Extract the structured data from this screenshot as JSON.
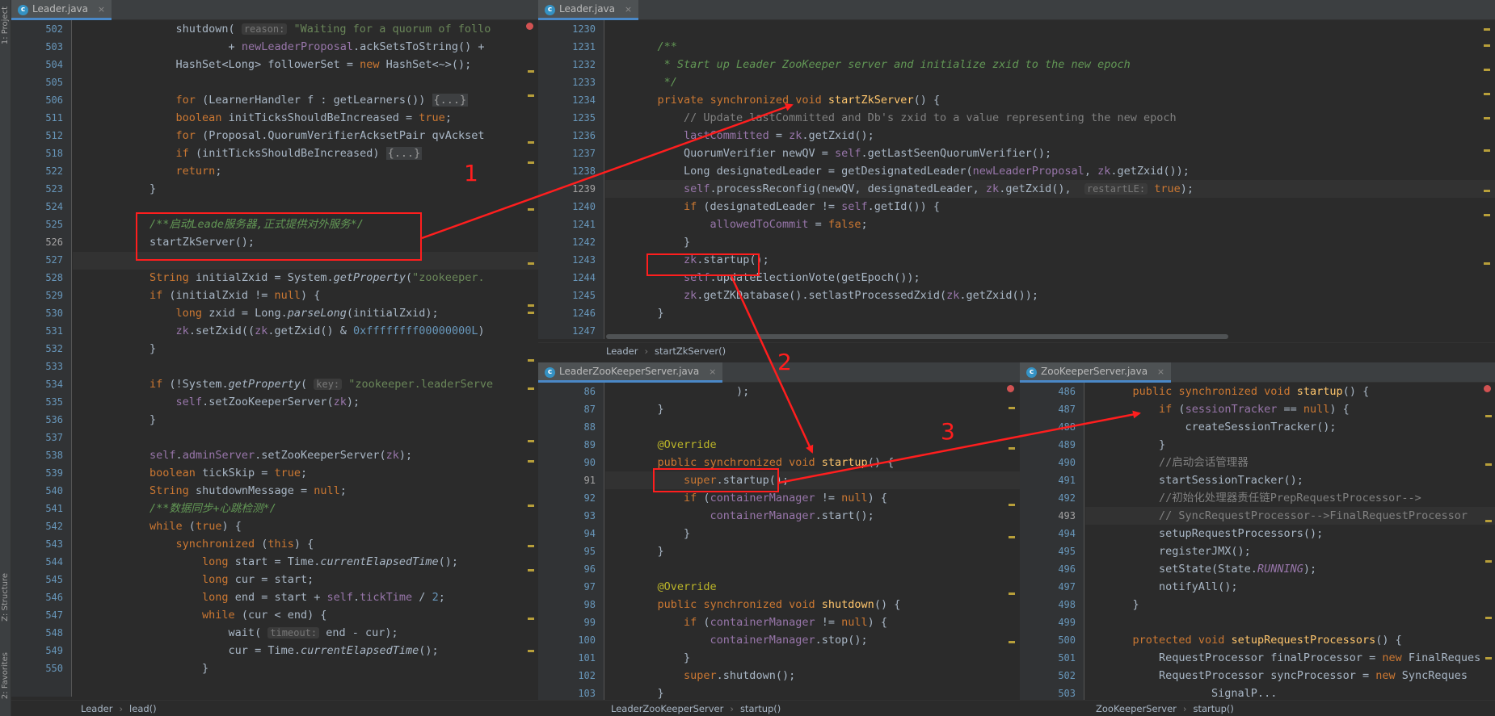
{
  "sidebar": {
    "project_label": "1: Project",
    "structure_label": "Z: Structure",
    "favorites_label": "2: Favorites"
  },
  "tabs": {
    "leader": "Leader.java",
    "leader_zk": "LeaderZooKeeperServer.java",
    "zk_server": "ZooKeeperServer.java",
    "close_glyph": "×",
    "class_glyph": "c"
  },
  "breadcrumbs": {
    "left": [
      "Leader",
      "lead()"
    ],
    "top_right": [
      "Leader",
      "startZkServer()"
    ],
    "middle": [
      "LeaderZooKeeperServer",
      "startup()"
    ],
    "right": [
      "ZooKeeperServer",
      "startup()"
    ],
    "separator": "›"
  },
  "annotations": {
    "label_1": "1",
    "label_2": "2",
    "label_3": "3"
  },
  "editor_left": {
    "lines": [
      {
        "n": "502",
        "t": "            shutdown( reason: \"Waiting for a quorum of follo"
      },
      {
        "n": "503",
        "t": "                    + newLeaderProposal.ackSetsToString() +"
      },
      {
        "n": "504",
        "t": "            HashSet<Long> followerSet = new HashSet<~>();"
      },
      {
        "n": "505",
        "t": ""
      },
      {
        "n": "506",
        "t": "            for (LearnerHandler f : getLearners()) {...}"
      },
      {
        "n": "511",
        "t": "            boolean initTicksShouldBeIncreased = true;"
      },
      {
        "n": "512",
        "t": "            for (Proposal.QuorumVerifierAcksetPair qvAckset"
      },
      {
        "n": "518",
        "t": "            if (initTicksShouldBeIncreased) {...}"
      },
      {
        "n": "522",
        "t": "            return;"
      },
      {
        "n": "523",
        "t": "        }"
      },
      {
        "n": "524",
        "t": ""
      },
      {
        "n": "525",
        "t": "        /**启动Leade服务器,正式提供对外服务*/"
      },
      {
        "n": "526",
        "t": "        startZkServer();"
      },
      {
        "n": "527",
        "t": ""
      },
      {
        "n": "528",
        "t": "        String initialZxid = System.getProperty(\"zookeeper."
      },
      {
        "n": "529",
        "t": "        if (initialZxid != null) {"
      },
      {
        "n": "530",
        "t": "            long zxid = Long.parseLong(initialZxid);"
      },
      {
        "n": "531",
        "t": "            zk.setZxid((zk.getZxid() & 0xffffffff00000000L)"
      },
      {
        "n": "532",
        "t": "        }"
      },
      {
        "n": "533",
        "t": ""
      },
      {
        "n": "534",
        "t": "        if (!System.getProperty( key: \"zookeeper.leaderServe"
      },
      {
        "n": "535",
        "t": "            self.setZooKeeperServer(zk);"
      },
      {
        "n": "536",
        "t": "        }"
      },
      {
        "n": "537",
        "t": ""
      },
      {
        "n": "538",
        "t": "        self.adminServer.setZooKeeperServer(zk);"
      },
      {
        "n": "539",
        "t": "        boolean tickSkip = true;"
      },
      {
        "n": "540",
        "t": "        String shutdownMessage = null;"
      },
      {
        "n": "541",
        "t": "        /**数据同步+心跳检测*/"
      },
      {
        "n": "542",
        "t": "        while (true) {"
      },
      {
        "n": "543",
        "t": "            synchronized (this) {"
      },
      {
        "n": "544",
        "t": "                long start = Time.currentElapsedTime();"
      },
      {
        "n": "545",
        "t": "                long cur = start;"
      },
      {
        "n": "546",
        "t": "                long end = start + self.tickTime / 2;"
      },
      {
        "n": "547",
        "t": "                while (cur < end) {"
      },
      {
        "n": "548",
        "t": "                    wait( timeout: end - cur);"
      },
      {
        "n": "549",
        "t": "                    cur = Time.currentElapsedTime();"
      },
      {
        "n": "550",
        "t": "                }"
      }
    ]
  },
  "editor_top_right": {
    "lines": [
      {
        "n": "1230",
        "t": ""
      },
      {
        "n": "1231",
        "t": "    /**"
      },
      {
        "n": "1232",
        "t": "     * Start up Leader ZooKeeper server and initialize zxid to the new epoch"
      },
      {
        "n": "1233",
        "t": "     */"
      },
      {
        "n": "1234",
        "t": "    private synchronized void startZkServer() {"
      },
      {
        "n": "1235",
        "t": "        // Update lastCommitted and Db's zxid to a value representing the new epoch"
      },
      {
        "n": "1236",
        "t": "        lastCommitted = zk.getZxid();"
      },
      {
        "n": "1237",
        "t": "        QuorumVerifier newQV = self.getLastSeenQuorumVerifier();"
      },
      {
        "n": "1238",
        "t": "        Long designatedLeader = getDesignatedLeader(newLeaderProposal, zk.getZxid());"
      },
      {
        "n": "1239",
        "t": "        self.processReconfig(newQV, designatedLeader, zk.getZxid(),  restartLE: true);"
      },
      {
        "n": "1240",
        "t": "        if (designatedLeader != self.getId()) {"
      },
      {
        "n": "1241",
        "t": "            allowedToCommit = false;"
      },
      {
        "n": "1242",
        "t": "        }"
      },
      {
        "n": "1243",
        "t": "        zk.startup();"
      },
      {
        "n": "1244",
        "t": "        self.updateElectionVote(getEpoch());"
      },
      {
        "n": "1245",
        "t": "        zk.getZKDatabase().setlastProcessedZxid(zk.getZxid());"
      },
      {
        "n": "1246",
        "t": "    }"
      },
      {
        "n": "1247",
        "t": ""
      }
    ]
  },
  "editor_middle": {
    "lines": [
      {
        "n": "86",
        "t": "                );"
      },
      {
        "n": "87",
        "t": "    }"
      },
      {
        "n": "88",
        "t": ""
      },
      {
        "n": "89",
        "t": "    @Override"
      },
      {
        "n": "90",
        "t": "    public synchronized void startup() {"
      },
      {
        "n": "91",
        "t": "        super.startup();"
      },
      {
        "n": "92",
        "t": "        if (containerManager != null) {"
      },
      {
        "n": "93",
        "t": "            containerManager.start();"
      },
      {
        "n": "94",
        "t": "        }"
      },
      {
        "n": "95",
        "t": "    }"
      },
      {
        "n": "96",
        "t": ""
      },
      {
        "n": "97",
        "t": "    @Override"
      },
      {
        "n": "98",
        "t": "    public synchronized void shutdown() {"
      },
      {
        "n": "99",
        "t": "        if (containerManager != null) {"
      },
      {
        "n": "100",
        "t": "            containerManager.stop();"
      },
      {
        "n": "101",
        "t": "        }"
      },
      {
        "n": "102",
        "t": "        super.shutdown();"
      },
      {
        "n": "103",
        "t": "    }"
      }
    ]
  },
  "editor_right": {
    "lines": [
      {
        "n": "486",
        "t": "    public synchronized void startup() {"
      },
      {
        "n": "487",
        "t": "        if (sessionTracker == null) {"
      },
      {
        "n": "488",
        "t": "            createSessionTracker();"
      },
      {
        "n": "489",
        "t": "        }"
      },
      {
        "n": "490",
        "t": "        //启动会话管理器"
      },
      {
        "n": "491",
        "t": "        startSessionTracker();"
      },
      {
        "n": "492",
        "t": "        //初始化处理器责任链PrepRequestProcessor-->"
      },
      {
        "n": "493",
        "t": "        // SyncRequestProcessor-->FinalRequestProcessor"
      },
      {
        "n": "494",
        "t": "        setupRequestProcessors();"
      },
      {
        "n": "495",
        "t": "        registerJMX();"
      },
      {
        "n": "496",
        "t": "        setState(State.RUNNING);"
      },
      {
        "n": "497",
        "t": "        notifyAll();"
      },
      {
        "n": "498",
        "t": "    }"
      },
      {
        "n": "499",
        "t": ""
      },
      {
        "n": "500",
        "t": "    protected void setupRequestProcessors() {"
      },
      {
        "n": "501",
        "t": "        RequestProcessor finalProcessor = new FinalReques"
      },
      {
        "n": "502",
        "t": "        RequestProcessor syncProcessor = new SyncReques"
      },
      {
        "n": "503",
        "t": "                SignalP..."
      }
    ]
  },
  "colors": {
    "keyword": "#cc7832",
    "function": "#ffc66d",
    "string": "#6a8759",
    "number": "#6897bb",
    "comment": "#808080",
    "doc_comment": "#629755",
    "field": "#9876aa",
    "annotation_red": "#ff1e1e"
  }
}
